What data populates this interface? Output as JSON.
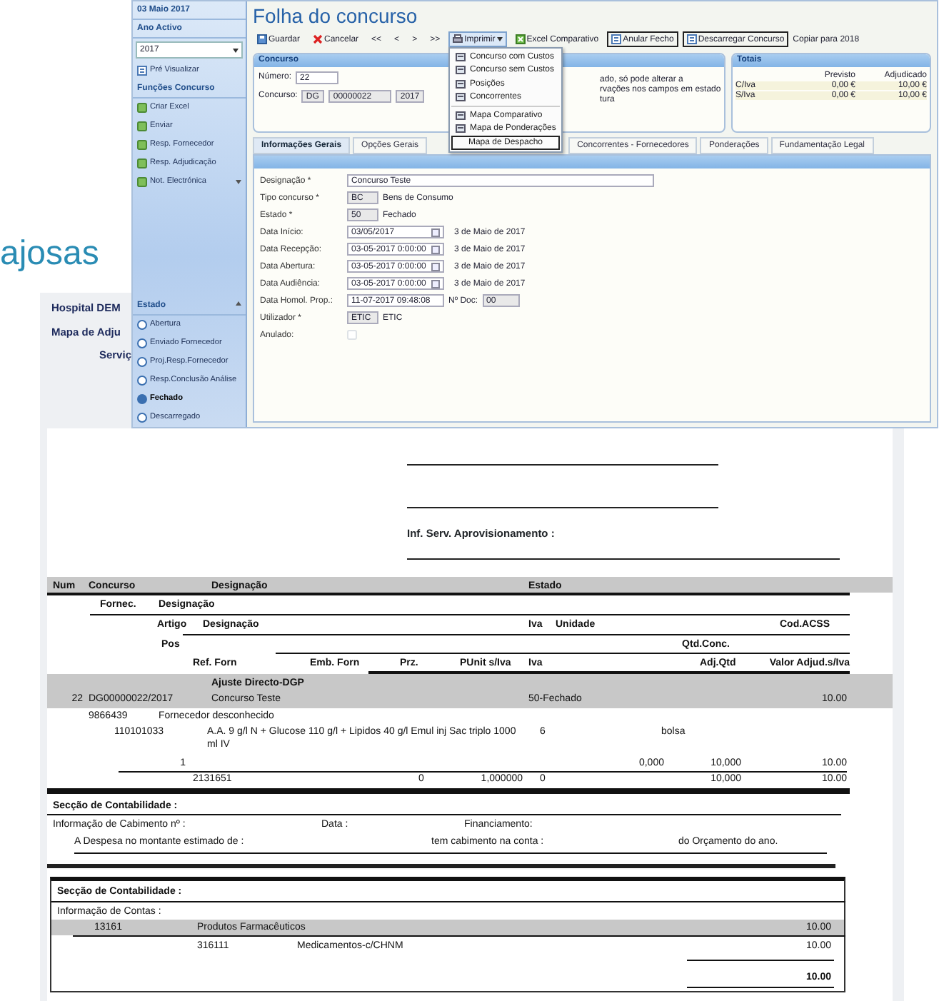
{
  "background": {
    "heading_fragment": "ajosas"
  },
  "report_header": {
    "lines": [
      "Hospital DEM",
      "Mapa de Adju",
      "Serviç"
    ]
  },
  "report": {
    "signature_label": "Inf. Serv. Aprovisionamento :",
    "rows": [
      {
        "kind": "head1",
        "cells": [
          "Num",
          "Concurso",
          "Designação",
          "Estado"
        ]
      },
      {
        "kind": "head2",
        "cells": [
          "Fornec.",
          "Designação"
        ]
      },
      {
        "kind": "head3",
        "cells": [
          "Artigo",
          "Designação",
          "Iva",
          "Unidade",
          "Cod.ACSS"
        ]
      },
      {
        "kind": "head4",
        "cells": [
          "Pos",
          "Qtd.Conc."
        ]
      },
      {
        "kind": "head5",
        "cells": [
          "Ref. Forn",
          "Emb. Forn",
          "Prz.",
          "PUnit s/Iva",
          "Iva",
          "Adj.Qtd",
          "Valor Adjud.s/Iva"
        ]
      },
      {
        "kind": "group_title",
        "cells": [
          "Ajuste Directo-DGP"
        ]
      },
      {
        "kind": "group_row",
        "cells": [
          "22",
          "DG00000022/2017",
          "Concurso Teste",
          "50-Fechado",
          "10.00"
        ]
      },
      {
        "kind": "supplier",
        "cells": [
          "9866439",
          "Fornecedor desconhecido"
        ]
      },
      {
        "kind": "article",
        "cells": [
          "110101033",
          "A.A. 9 g/l N + Glucose 110 g/l + Lipidos 40 g/l Emul inj Sac triplo 1000 ml IV",
          "6",
          "bolsa"
        ]
      },
      {
        "kind": "pos",
        "cells": [
          "1",
          "",
          "",
          "",
          "0,000",
          "10,000",
          "10.00"
        ]
      },
      {
        "kind": "ref",
        "cells": [
          "2131651",
          "",
          "0",
          "1,000000",
          "0",
          "10,000",
          "10.00"
        ]
      }
    ],
    "accounting": [
      {
        "kind": "section",
        "cells": [
          "Secção de Contabilidade :"
        ]
      },
      {
        "kind": "cabimento",
        "cells": [
          "Informação de Cabimento nº :",
          "Data :",
          "Financiamento:"
        ]
      },
      {
        "kind": "despesa",
        "cells": [
          "A Despesa no montante estimado de :",
          "tem cabimento na conta :",
          "do Orçamento do ano."
        ]
      },
      {
        "kind": "box_section",
        "cells": [
          "Secção de Contabilidade :"
        ]
      },
      {
        "kind": "box_info",
        "cells": [
          "Informação de Contas :"
        ]
      },
      {
        "kind": "account",
        "cells": [
          "13161",
          "Produtos Farmacêuticos",
          "10.00"
        ]
      },
      {
        "kind": "subaccount",
        "cells": [
          "316111",
          "Medicamentos-c/CHNM",
          "10.00"
        ]
      },
      {
        "kind": "total",
        "cells": [
          "10.00"
        ]
      }
    ]
  },
  "app": {
    "sidebar": {
      "date": "03 Maio 2017",
      "year_header": "Ano Activo",
      "year": "2017",
      "preview": "Pré Visualizar",
      "functions_header": "Funções Concurso",
      "functions": [
        {
          "label": "Criar Excel",
          "has_menu": false
        },
        {
          "label": "Enviar",
          "has_menu": false
        },
        {
          "label": "Resp. Fornecedor",
          "has_menu": false
        },
        {
          "label": "Resp. Adjudicação",
          "has_menu": false
        },
        {
          "label": "Not. Electrónica",
          "has_menu": true
        }
      ],
      "state_header": "Estado",
      "states": [
        {
          "label": "Abertura",
          "selected": false
        },
        {
          "label": "Enviado Fornecedor",
          "selected": false
        },
        {
          "label": "Proj.Resp.Fornecedor",
          "selected": false
        },
        {
          "label": "Resp.Conclusão Análise",
          "selected": false
        },
        {
          "label": "Fechado",
          "selected": true
        },
        {
          "label": "Descarregado",
          "selected": false
        }
      ]
    },
    "title": "Folha do concurso",
    "toolbar": [
      {
        "kind": "save",
        "label": "Guardar"
      },
      {
        "kind": "cancel",
        "label": "Cancelar"
      },
      {
        "kind": "nav",
        "label": "<<"
      },
      {
        "kind": "nav",
        "label": "<"
      },
      {
        "kind": "nav",
        "label": ">"
      },
      {
        "kind": "nav",
        "label": ">>"
      },
      {
        "kind": "print",
        "label": "Imprimir",
        "expanded": true
      },
      {
        "kind": "export",
        "label": "Excel Comparativo"
      },
      {
        "kind": "action",
        "label": "Anular Fecho"
      },
      {
        "kind": "action",
        "label": "Descarregar Concurso"
      },
      {
        "kind": "text",
        "label": "Copiar para 2018"
      }
    ],
    "print_menu": [
      {
        "kind": "report",
        "label": "Concurso com Custos",
        "separator_before": false,
        "selected": false
      },
      {
        "kind": "report",
        "label": "Concurso sem Custos",
        "separator_before": false,
        "selected": false
      },
      {
        "kind": "report",
        "label": "Posições",
        "separator_before": false,
        "selected": false
      },
      {
        "kind": "report",
        "label": "Concorrentes",
        "separator_before": false,
        "selected": false
      },
      {
        "kind": "report",
        "label": "Mapa Comparativo",
        "separator_before": true,
        "selected": false
      },
      {
        "kind": "report",
        "label": "Mapa de Ponderações",
        "separator_before": false,
        "selected": false
      },
      {
        "kind": "plain",
        "label": "Mapa de Despacho",
        "separator_before": false,
        "selected": true
      }
    ],
    "concurso_panel": {
      "title": "Concurso",
      "number_label": "Número:",
      "number": "22",
      "concurso_label": "Concurso:",
      "series": "DG",
      "code": "00000022",
      "year": "2017",
      "notice_lines": [
        "ado, só pode alterar a",
        "rvações nos campos em estado",
        "tura"
      ]
    },
    "totals": {
      "title": "Totais",
      "columns": [
        "Previsto",
        "Adjudicado"
      ],
      "rows": [
        {
          "label": "C/Iva",
          "values": [
            "0,00 €",
            "10,00 €"
          ]
        },
        {
          "label": "S/Iva",
          "values": [
            "0,00 €",
            "10,00 €"
          ]
        }
      ]
    },
    "tabs": [
      {
        "label": "Informações Gerais",
        "selected": true
      },
      {
        "label": "Opções Gerais",
        "selected": false
      },
      {
        "label": "Concorrentes - Fornecedores",
        "selected": false
      },
      {
        "label": "Ponderações",
        "selected": false
      },
      {
        "label": "Fundamentação Legal",
        "selected": false
      }
    ],
    "form": [
      {
        "kind": "text",
        "label": "Designação *",
        "value": "Concurso Teste"
      },
      {
        "kind": "code",
        "label": "Tipo concurso *",
        "code": "BC",
        "description": "Bens de Consumo"
      },
      {
        "kind": "code",
        "label": "Estado *",
        "code": "50",
        "description": "Fechado"
      },
      {
        "kind": "date",
        "label": "Data Início:",
        "value": "03/05/2017",
        "long_date": "3 de Maio de 2017"
      },
      {
        "kind": "date",
        "label": "Data Recepção:",
        "value": "03-05-2017 0:00:00",
        "long_date": "3 de Maio de 2017"
      },
      {
        "kind": "date",
        "label": "Data Abertura:",
        "value": "03-05-2017 0:00:00",
        "long_date": "3 de Maio de 2017"
      },
      {
        "kind": "date",
        "label": "Data Audiência:",
        "value": "03-05-2017 0:00:00",
        "long_date": "3 de Maio de 2017"
      },
      {
        "kind": "doc",
        "label": "Data Homol. Prop.:",
        "value": "11-07-2017 09:48:08",
        "doc_label": "Nº Doc:",
        "doc_value": "00"
      },
      {
        "kind": "code",
        "label": "Utilizador *",
        "code": "ETIC",
        "description": "ETIC"
      },
      {
        "kind": "check",
        "label": "Anulado:",
        "checked": false
      }
    ]
  }
}
